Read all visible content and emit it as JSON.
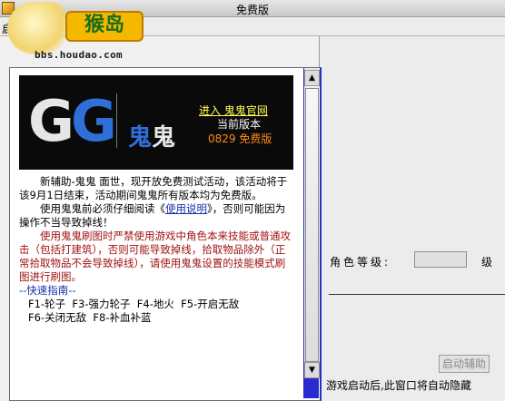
{
  "window": {
    "title": "免费版"
  },
  "watermark": {
    "brand": "猴岛",
    "url": "bbs.houdao.com"
  },
  "menu": {
    "start": "启动"
  },
  "banner": {
    "logo_g1": "G",
    "logo_g2": "G",
    "name_1": "鬼",
    "name_2": "鬼",
    "enter_link": "进入 鬼鬼官网",
    "version_label": "当前版本",
    "version_value": "0829 免费版"
  },
  "article": {
    "p1": "新辅助-鬼鬼 面世，现开放免费测试活动，该活动将于该9月1日结束，活动期间鬼鬼所有版本均为免费版。",
    "p2_before": "使用鬼鬼前必须仔细阅读《",
    "p2_link": "使用说明",
    "p2_after": "》，否则可能因为操作不当导致掉线！",
    "p3": "使用鬼鬼刷图时严禁使用游戏中角色本来技能或普通攻击（包括打建筑），否则可能导致掉线，拾取物品除外（正常拾取物品不会导致掉线），请使用鬼鬼设置的技能模式刷图进行刷图。",
    "guide_title": "--快速指南--",
    "guide_line1": "F1-轮子  F3-强力轮子  F4-地火  F5-开启无敌",
    "guide_line2": "F6-关闭无敌  F8-补血补蓝"
  },
  "right_panel": {
    "role_level_label": "角色等级:",
    "level_unit": "级",
    "role_level_value": "",
    "start_button": "启动辅助",
    "hint": "游戏启动后,此窗口将自动隐藏"
  },
  "colors": {
    "accent_blue": "#2f6fd9",
    "link_yellow": "#ffff55",
    "version_orange": "#ff8a1a",
    "warning_red": "#a01212"
  }
}
